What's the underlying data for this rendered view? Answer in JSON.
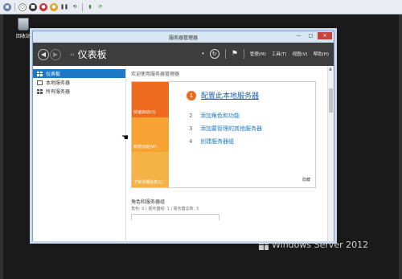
{
  "desktop": {
    "recycle_bin_label": "回收站",
    "brand_text": "Windows Server 2012"
  },
  "window": {
    "title": "服务器管理器",
    "controls": {
      "minimize": "—",
      "maximize": "□",
      "close": "✕"
    }
  },
  "header": {
    "back": "◀",
    "forward": "▶",
    "chevrons": "‹‹",
    "title": "仪表板",
    "refresh": "↻",
    "flag": "⚑",
    "menus": [
      "管理(M)",
      "工具(T)",
      "视图(V)",
      "帮助(H)"
    ]
  },
  "sidebar": {
    "items": [
      {
        "label": "仪表板",
        "active": true
      },
      {
        "label": "本地服务器",
        "active": false
      },
      {
        "label": "所有服务器",
        "active": false
      }
    ]
  },
  "main": {
    "welcome": "欢迎使用服务器管理器",
    "tiles": [
      "快速启动(Q)",
      "新增功能(W)",
      "了解详细信息(L)"
    ],
    "step1": {
      "num": "1",
      "label": "配置此本地服务器"
    },
    "steps": [
      {
        "num": "2",
        "label": "添加角色和功能"
      },
      {
        "num": "3",
        "label": "添加要管理的其他服务器"
      },
      {
        "num": "4",
        "label": "创建服务器组"
      }
    ],
    "hide": "隐藏",
    "roles_title": "角色和服务器组",
    "roles_sub": "角色: 0 | 服务器组: 1 | 服务器总数: 3"
  },
  "colors": {
    "accent_blue": "#1d79c5",
    "tile_orange": "#ed6a1f",
    "tile_amber": "#f7a334",
    "header_dark": "#3d3d3d"
  }
}
